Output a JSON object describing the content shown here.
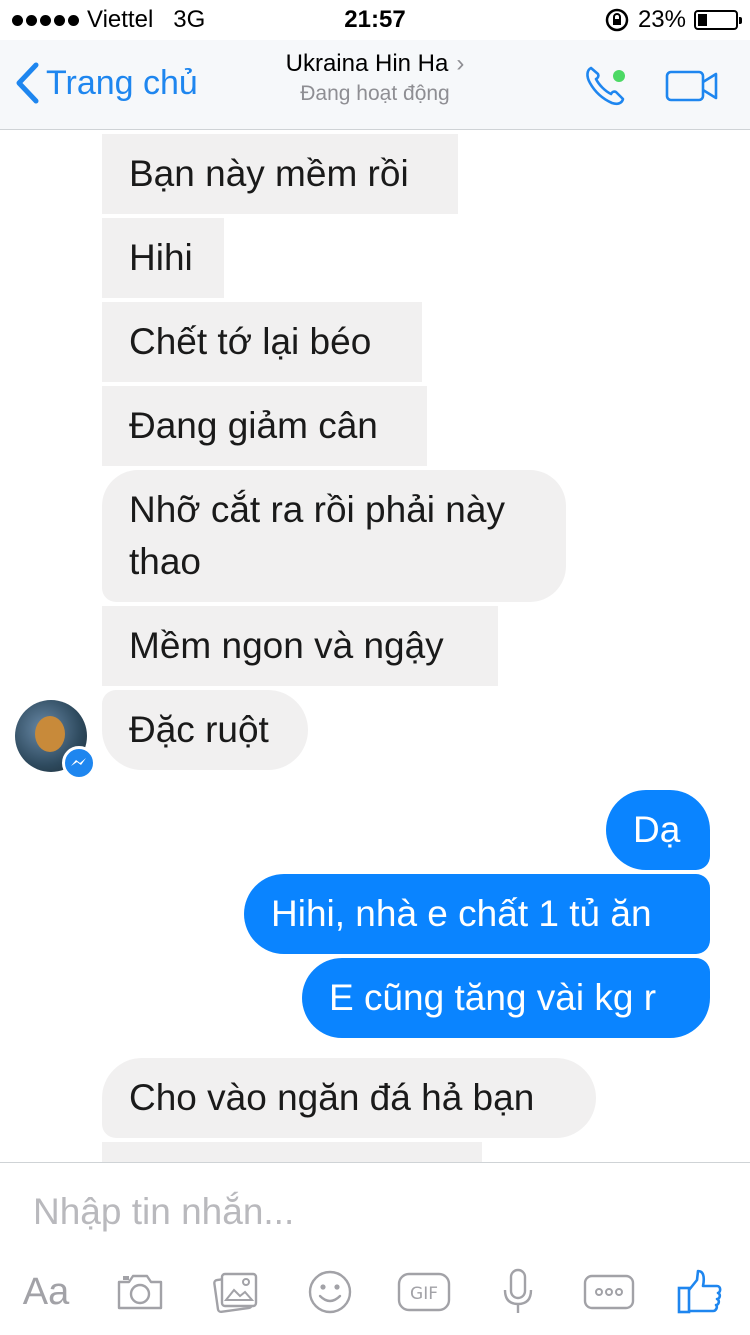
{
  "status_bar": {
    "carrier": "Viettel",
    "network": "3G",
    "time": "21:57",
    "battery": "23%",
    "battery_level": 0.23
  },
  "header": {
    "back_label": "Trang chủ",
    "contact_name": "Ukraina Hin Ha",
    "presence": "Đang hoạt động",
    "online_dot_color": "#4cd964"
  },
  "messages": [
    {
      "sender": "them",
      "text": "Bạn này mềm rồi"
    },
    {
      "sender": "them",
      "text": "Hihi"
    },
    {
      "sender": "them",
      "text": "Chết tớ lại béo"
    },
    {
      "sender": "them",
      "text": "Đang giảm cân"
    },
    {
      "sender": "them",
      "text_line1": "Nhỡ cắt ra rồi phải này",
      "text_line2": "thao"
    },
    {
      "sender": "them",
      "text": "Mềm ngon và ngậy"
    },
    {
      "sender": "them",
      "text": "Đặc ruột"
    },
    {
      "sender": "me",
      "text": "Dạ"
    },
    {
      "sender": "me",
      "text": "Hihi, nhà e chất 1 tủ ăn"
    },
    {
      "sender": "me",
      "text": "E cũng tăng vài kg r"
    },
    {
      "sender": "them",
      "text": "Cho vào ngăn đá hả bạn"
    }
  ],
  "composer": {
    "placeholder": "Nhập tin nhắn...",
    "tools": [
      {
        "icon": "text-format-icon",
        "label": "Aa"
      },
      {
        "icon": "camera-icon"
      },
      {
        "icon": "photo-icon"
      },
      {
        "icon": "emoji-icon"
      },
      {
        "icon": "gif-icon",
        "label": "GIF"
      },
      {
        "icon": "microphone-icon"
      },
      {
        "icon": "more-icon"
      },
      {
        "icon": "like-icon"
      }
    ]
  },
  "colors": {
    "accent": "#1e86ef",
    "outgoing_bubble": "#0a84ff",
    "incoming_bubble": "#f1f0f0"
  }
}
